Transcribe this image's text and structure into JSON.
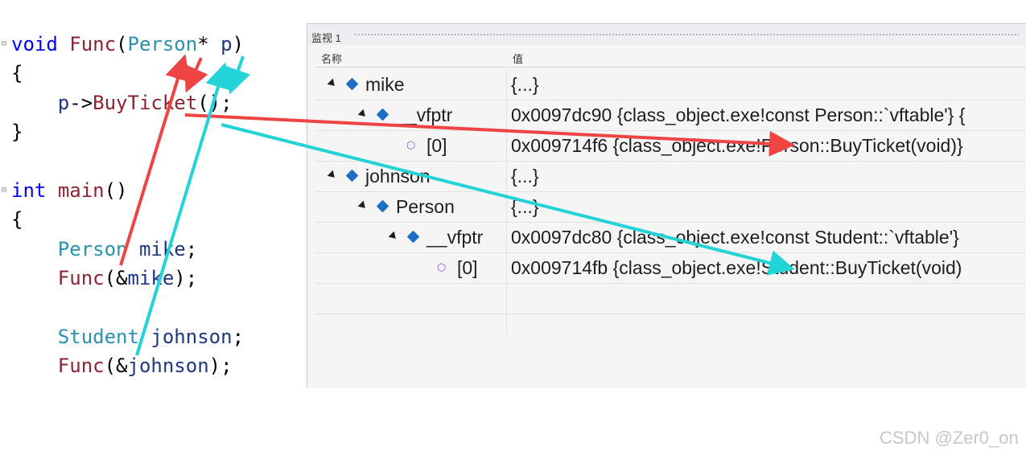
{
  "code": {
    "lines": [
      {
        "parts": [
          {
            "t": "void",
            "c": "kw"
          },
          {
            "t": " ",
            "c": "pl"
          },
          {
            "t": "Func",
            "c": "fn"
          },
          {
            "t": "(",
            "c": "pl"
          },
          {
            "t": "Person",
            "c": "ty"
          },
          {
            "t": "* ",
            "c": "pl"
          },
          {
            "t": "p",
            "c": "va"
          },
          {
            "t": ")",
            "c": "pl"
          }
        ]
      },
      {
        "parts": [
          {
            "t": "{",
            "c": "pl"
          }
        ]
      },
      {
        "parts": [
          {
            "t": "    ",
            "c": "pl"
          },
          {
            "t": "p",
            "c": "va"
          },
          {
            "t": "->",
            "c": "pl"
          },
          {
            "t": "BuyTicket",
            "c": "fn"
          },
          {
            "t": "();",
            "c": "pl"
          }
        ]
      },
      {
        "parts": [
          {
            "t": "}",
            "c": "pl"
          }
        ]
      },
      {
        "parts": []
      },
      {
        "parts": [
          {
            "t": "int",
            "c": "kw"
          },
          {
            "t": " ",
            "c": "pl"
          },
          {
            "t": "main",
            "c": "fn"
          },
          {
            "t": "()",
            "c": "pl"
          }
        ]
      },
      {
        "parts": [
          {
            "t": "{",
            "c": "pl"
          }
        ]
      },
      {
        "parts": [
          {
            "t": "    ",
            "c": "pl"
          },
          {
            "t": "Person",
            "c": "ty"
          },
          {
            "t": " ",
            "c": "pl"
          },
          {
            "t": "mike",
            "c": "va"
          },
          {
            "t": ";",
            "c": "pl"
          }
        ]
      },
      {
        "parts": [
          {
            "t": "    ",
            "c": "pl"
          },
          {
            "t": "Func",
            "c": "fn"
          },
          {
            "t": "(&",
            "c": "pl"
          },
          {
            "t": "mike",
            "c": "va"
          },
          {
            "t": ");",
            "c": "pl"
          }
        ]
      },
      {
        "parts": []
      },
      {
        "parts": [
          {
            "t": "    ",
            "c": "pl"
          },
          {
            "t": "Student",
            "c": "ty"
          },
          {
            "t": " ",
            "c": "pl"
          },
          {
            "t": "johnson",
            "c": "va"
          },
          {
            "t": ";",
            "c": "pl"
          }
        ]
      },
      {
        "parts": [
          {
            "t": "    ",
            "c": "pl"
          },
          {
            "t": "Func",
            "c": "fn"
          },
          {
            "t": "(&",
            "c": "pl"
          },
          {
            "t": "johnson",
            "c": "va"
          },
          {
            "t": ");",
            "c": "pl"
          }
        ]
      }
    ]
  },
  "watch": {
    "title": "监视 1",
    "col_name": "名称",
    "col_value": "值",
    "rows": [
      {
        "name": "mike",
        "value": "{...}",
        "icon": "cube-icon",
        "expander": true
      },
      {
        "name": "__vfptr",
        "value": "0x0097dc90 {class_object.exe!const Person::`vftable'} {",
        "icon": "cube-icon",
        "expander": true
      },
      {
        "name": "[0]",
        "value": "0x009714f6 {class_object.exe!Person::BuyTicket(void)}",
        "icon": "method-icon",
        "expander": false
      },
      {
        "name": "johnson",
        "value": "{...}",
        "icon": "cube-icon",
        "expander": true
      },
      {
        "name": "Person",
        "value": "{...}",
        "icon": "cube-icon",
        "expander": true
      },
      {
        "name": "__vfptr",
        "value": "0x0097dc80 {class_object.exe!const Student::`vftable'}",
        "icon": "cube-icon",
        "expander": true
      },
      {
        "name": "[0]",
        "value": "0x009714fb {class_object.exe!Student::BuyTicket(void)",
        "icon": "method-icon",
        "expander": false
      },
      {
        "name": "",
        "value": "",
        "icon": "",
        "expander": false
      }
    ]
  },
  "colors": {
    "red_arrow": "#ef4444",
    "cyan_arrow": "#22d3d8"
  },
  "watermark": "CSDN @Zer0_on"
}
